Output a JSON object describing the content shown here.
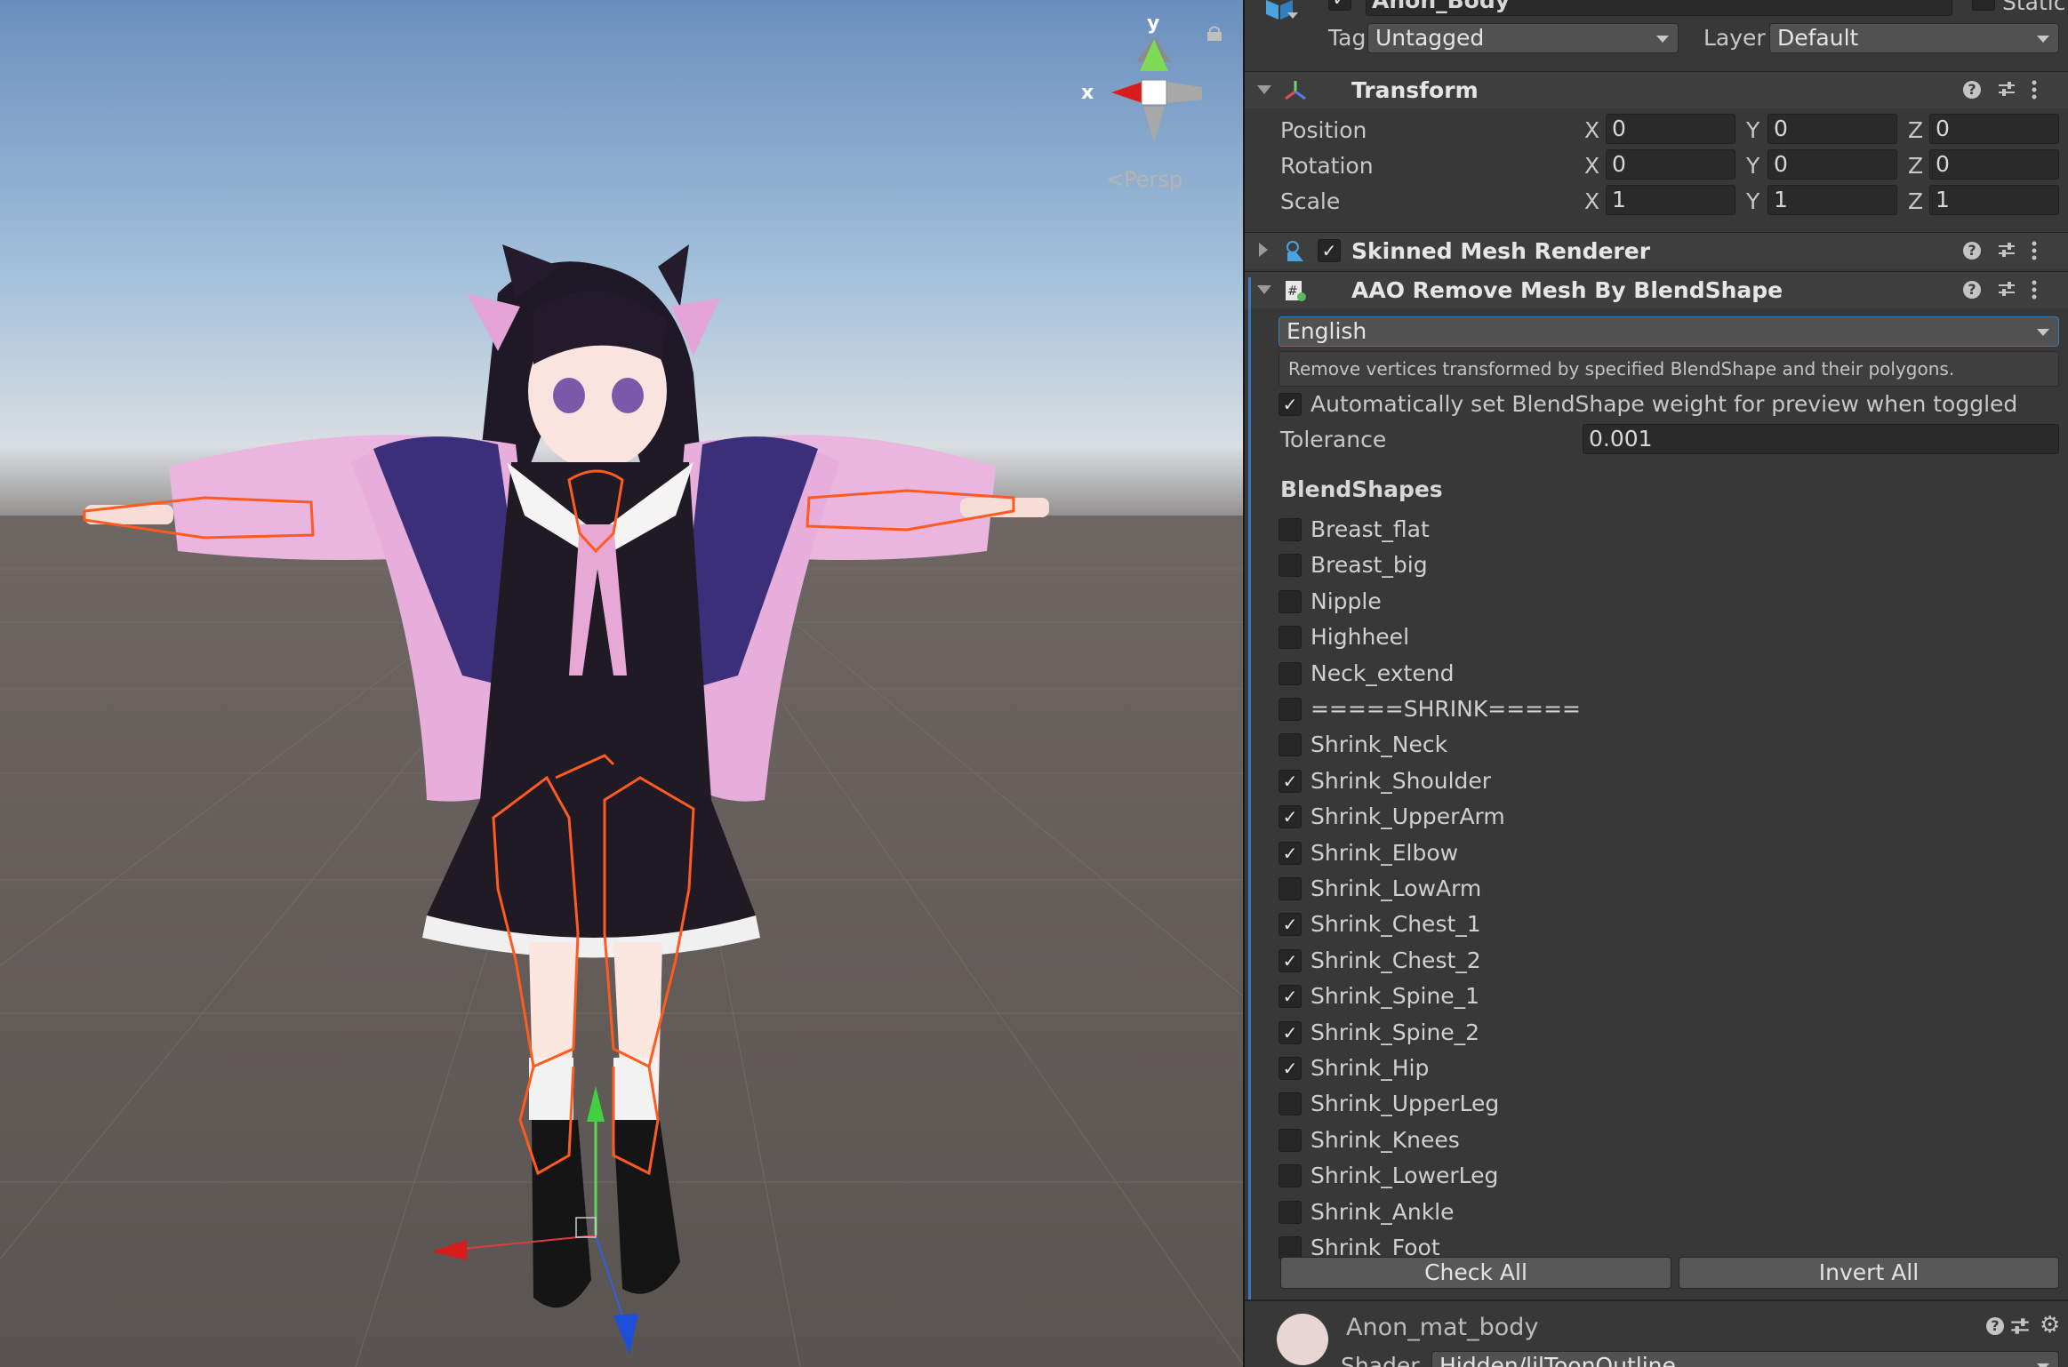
{
  "scene": {
    "gizmo": {
      "y_label": "y",
      "x_label": "x",
      "projection": "Persp"
    },
    "icons": [
      "lock-icon",
      "view-gizmo-icon",
      "move-handle-icon"
    ]
  },
  "inspector": {
    "object": {
      "name": "Anon_Body",
      "static_label": "Static"
    },
    "tag": {
      "label": "Tag",
      "value": "Untagged"
    },
    "layer": {
      "label": "Layer",
      "value": "Default"
    },
    "transform": {
      "title": "Transform",
      "rows": [
        {
          "label": "Position",
          "x": "0",
          "y": "0",
          "z": "0"
        },
        {
          "label": "Rotation",
          "x": "0",
          "y": "0",
          "z": "0"
        },
        {
          "label": "Scale",
          "x": "1",
          "y": "1",
          "z": "1"
        }
      ],
      "axis": {
        "x": "X",
        "y": "Y",
        "z": "Z"
      }
    },
    "skinned_mesh": {
      "title": "Skinned Mesh Renderer",
      "enabled": true
    },
    "aao": {
      "title": "AAO Remove Mesh By BlendShape",
      "language": "English",
      "help": "Remove vertices transformed by specified BlendShape and their polygons.",
      "auto_preview_label": "Automatically set BlendShape weight for preview when toggled",
      "auto_preview_checked": true,
      "tolerance_label": "Tolerance",
      "tolerance_value": "0.001",
      "blendshapes_label": "BlendShapes",
      "blendshapes": [
        {
          "name": "Breast_flat",
          "checked": false
        },
        {
          "name": "Breast_big",
          "checked": false
        },
        {
          "name": "Nipple",
          "checked": false
        },
        {
          "name": "Highheel",
          "checked": false
        },
        {
          "name": "Neck_extend",
          "checked": false
        },
        {
          "name": "=====SHRINK=====",
          "checked": false
        },
        {
          "name": "Shrink_Neck",
          "checked": false
        },
        {
          "name": "Shrink_Shoulder",
          "checked": true
        },
        {
          "name": "Shrink_UpperArm",
          "checked": true
        },
        {
          "name": "Shrink_Elbow",
          "checked": true
        },
        {
          "name": "Shrink_LowArm",
          "checked": false
        },
        {
          "name": "Shrink_Chest_1",
          "checked": true
        },
        {
          "name": "Shrink_Chest_2",
          "checked": true
        },
        {
          "name": "Shrink_Spine_1",
          "checked": true
        },
        {
          "name": "Shrink_Spine_2",
          "checked": true
        },
        {
          "name": "Shrink_Hip",
          "checked": true
        },
        {
          "name": "Shrink_UpperLeg",
          "checked": false
        },
        {
          "name": "Shrink_Knees",
          "checked": false
        },
        {
          "name": "Shrink_LowerLeg",
          "checked": false
        },
        {
          "name": "Shrink_Ankle",
          "checked": false
        },
        {
          "name": "Shrink_Foot",
          "checked": false
        }
      ],
      "check_all": "Check All",
      "invert_all": "Invert All"
    },
    "material": {
      "name": "Anon_mat_body",
      "shader_label": "Shader",
      "shader_value": "Hidden/lilToonOutline"
    }
  },
  "colors": {
    "accent": "#3a79bb",
    "panel": "#383838",
    "header": "#3e3e3e",
    "selection": "#ff5a1f"
  }
}
